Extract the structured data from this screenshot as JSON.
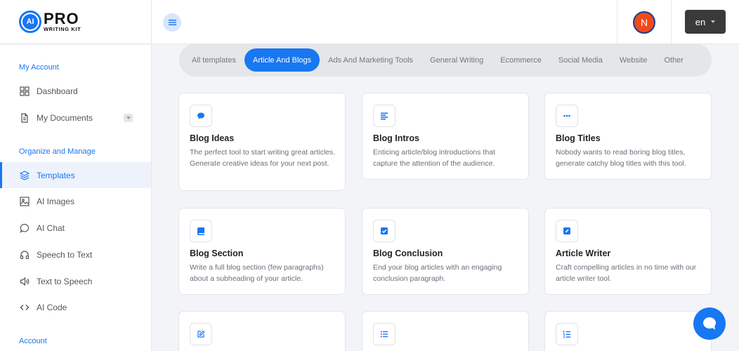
{
  "brand": {
    "logo_text": "PRO",
    "logo_sub": "WRITING KIT",
    "logo_mark": "AI"
  },
  "header": {
    "avatar_initial": "N",
    "language": "en"
  },
  "sidebar": {
    "sections": [
      {
        "title": "My Account"
      },
      {
        "title": "Organize and Manage"
      },
      {
        "title": "Account"
      }
    ],
    "items": [
      {
        "label": "Dashboard",
        "icon": "grid-icon"
      },
      {
        "label": "My Documents",
        "icon": "document-icon"
      },
      {
        "label": "Templates",
        "icon": "layers-icon",
        "active": true
      },
      {
        "label": "AI Images",
        "icon": "image-icon"
      },
      {
        "label": "AI Chat",
        "icon": "chat-icon"
      },
      {
        "label": "Speech to Text",
        "icon": "headphones-icon"
      },
      {
        "label": "Text to Speech",
        "icon": "speaker-icon"
      },
      {
        "label": "AI Code",
        "icon": "code-icon"
      }
    ]
  },
  "tabs": [
    {
      "label": "All templates"
    },
    {
      "label": "Article And Blogs",
      "active": true
    },
    {
      "label": "Ads And Marketing Tools"
    },
    {
      "label": "General Writing"
    },
    {
      "label": "Ecommerce"
    },
    {
      "label": "Social Media"
    },
    {
      "label": "Website"
    },
    {
      "label": "Other"
    }
  ],
  "cards": [
    {
      "title": "Blog Ideas",
      "desc": "The perfect tool to start writing great articles. Generate creative ideas for your next post.",
      "icon": "speech-bubble-icon"
    },
    {
      "title": "Blog Intros",
      "desc": "Enticing article/blog introductions that capture the attention of the audience.",
      "icon": "align-left-icon"
    },
    {
      "title": "Blog Titles",
      "desc": "Nobody wants to read boring blog titles, generate catchy blog titles with this tool.",
      "icon": "ellipsis-icon"
    },
    {
      "title": "Blog Section",
      "desc": "Write a full blog section (few paragraphs) about a subheading of your article.",
      "icon": "book-icon"
    },
    {
      "title": "Blog Conclusion",
      "desc": "End your blog articles with an engaging conclusion paragraph.",
      "icon": "check-square-icon"
    },
    {
      "title": "Article Writer",
      "desc": "Craft compelling articles in no time with our article writer tool.",
      "icon": "pen-square-icon"
    },
    {
      "title": "",
      "desc": "",
      "icon": "edit-icon"
    },
    {
      "title": "",
      "desc": "",
      "icon": "list-icon"
    },
    {
      "title": "",
      "desc": "",
      "icon": "numbered-list-icon"
    }
  ],
  "colors": {
    "accent": "#1877f2",
    "avatar_bg": "#f04a1a",
    "lang_bg": "#3a3a3a"
  }
}
